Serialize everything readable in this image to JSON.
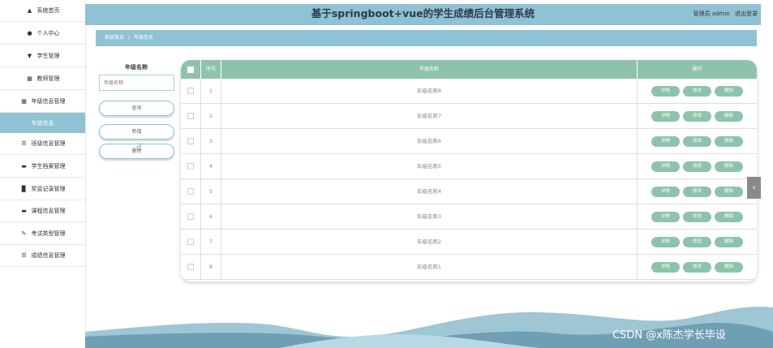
{
  "header": {
    "title": "基于springboot+vue的学生成绩后台管理系统",
    "user": "管理员 admin",
    "logout": "退出登录"
  },
  "sidebar": {
    "items": [
      {
        "label": "系统首页",
        "icon": "home-icon"
      },
      {
        "label": "个人中心",
        "icon": "user-icon"
      },
      {
        "label": "学生管理",
        "icon": "student-icon"
      },
      {
        "label": "教师管理",
        "icon": "grid-icon"
      },
      {
        "label": "年级信息管理",
        "icon": "grid-icon"
      },
      {
        "label": "年级信息",
        "icon": "",
        "active": true
      },
      {
        "label": "班级信息管理",
        "icon": "list-icon"
      },
      {
        "label": "学生档案管理",
        "icon": "monitor-icon"
      },
      {
        "label": "奖惩记录管理",
        "icon": "bar-chart-icon"
      },
      {
        "label": "课程信息管理",
        "icon": "monitor-icon"
      },
      {
        "label": "考试类型管理",
        "icon": "edit-icon"
      },
      {
        "label": "成绩信息管理",
        "icon": "list-icon"
      }
    ]
  },
  "breadcrumb": {
    "home": "系统首页",
    "separator": "/",
    "current": "年级信息"
  },
  "search": {
    "label": "年级名称",
    "placeholder": "年级名称",
    "query_button": "查询",
    "add_button": "新增",
    "delete_button": "删除"
  },
  "table": {
    "headers": {
      "index": "序号",
      "name": "年级名称",
      "actions": "操作"
    },
    "rows": [
      {
        "index": "1",
        "name": "年级名称8"
      },
      {
        "index": "2",
        "name": "年级名称7"
      },
      {
        "index": "3",
        "name": "年级名称6"
      },
      {
        "index": "4",
        "name": "年级名称5"
      },
      {
        "index": "5",
        "name": "年级名称4"
      },
      {
        "index": "6",
        "name": "年级名称3"
      },
      {
        "index": "7",
        "name": "年级名称2"
      },
      {
        "index": "8",
        "name": "年级名称1"
      }
    ],
    "actions": {
      "detail": "详情",
      "edit": "修改",
      "delete": "删除"
    }
  },
  "watermark": "CSDN @x陈杰学长毕设",
  "colors": {
    "accent": "#8fc2d2",
    "table_header": "#8ec3ab",
    "wave_dark": "#6f9fb4",
    "wave_light": "#9ec6d4"
  }
}
